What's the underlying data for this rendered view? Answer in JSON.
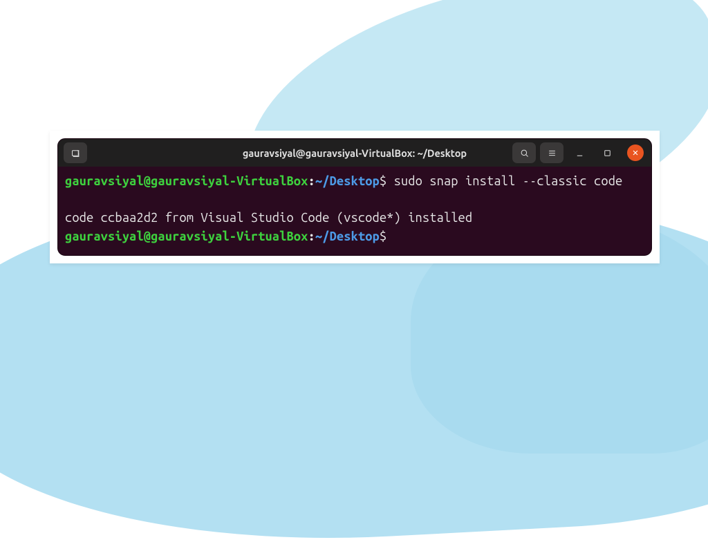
{
  "titlebar": {
    "title": "gauravsiyal@gauravsiyal-VirtualBox: ~/Desktop"
  },
  "terminal": {
    "line1": {
      "user": "gauravsiyal",
      "at": "@",
      "host": "gauravsiyal-VirtualBox",
      "colon": ":",
      "tilde": "~",
      "path": "/Desktop",
      "dollar": "$",
      "command": " sudo snap install --classic code"
    },
    "line2_output": "code ccbaa2d2 from Visual Studio Code (vscode*) installed",
    "line3": {
      "user": "gauravsiyal",
      "at": "@",
      "host": "gauravsiyal-VirtualBox",
      "colon": ":",
      "tilde": "~",
      "path": "/Desktop",
      "dollar": "$"
    }
  },
  "icons": {
    "new_tab": "new-tab-icon",
    "search": "search-icon",
    "menu": "hamburger-icon",
    "minimize": "minimize-icon",
    "maximize": "maximize-icon",
    "close": "close-icon"
  }
}
